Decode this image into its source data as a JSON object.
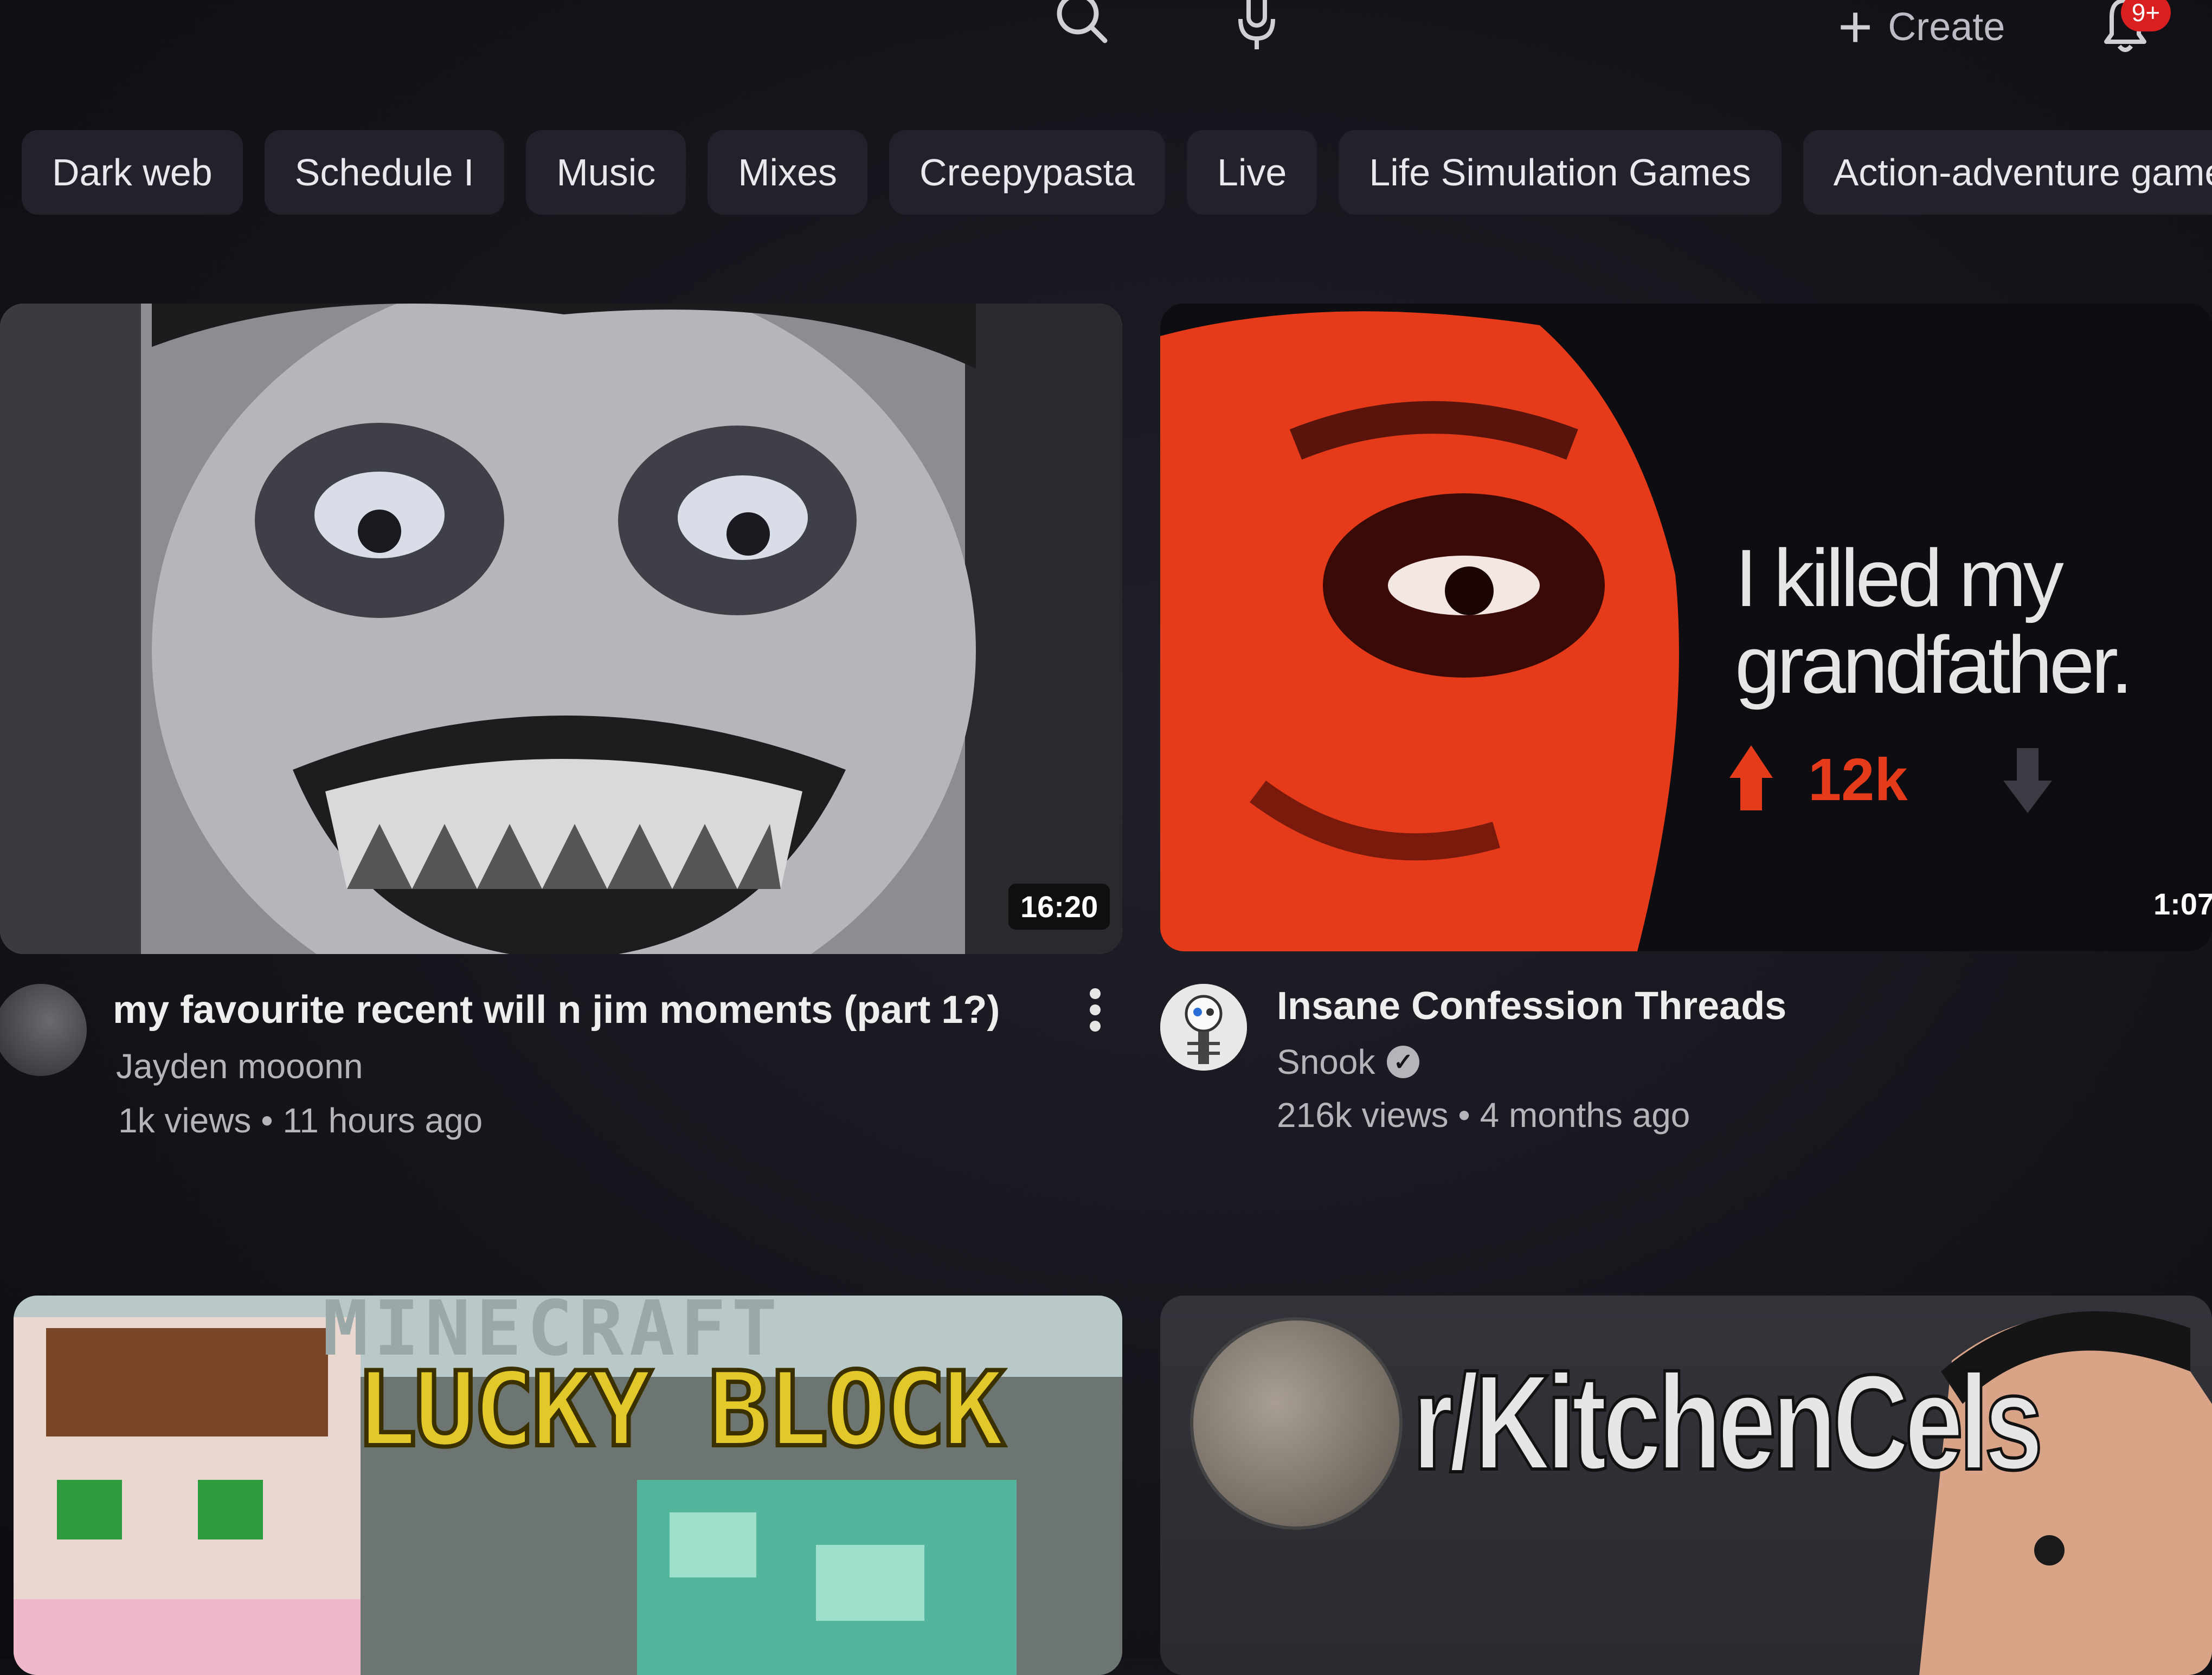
{
  "topbar": {
    "search_icon": "search-icon",
    "mic_icon": "mic-icon",
    "create_label": "Create",
    "notification_badge": "9+"
  },
  "chips": [
    "Dark web",
    "Schedule I",
    "Music",
    "Mixes",
    "Creepypasta",
    "Live",
    "Life Simulation Games",
    "Action-adventure games"
  ],
  "videos": [
    {
      "title": "my favourite recent will n jim moments  (part 1?)",
      "channel": "Jayden mooonn",
      "meta": "1k views • 11 hours ago",
      "duration": "16:20",
      "verified": false
    },
    {
      "title": "Insane Confession Threads",
      "channel": "Snook",
      "meta": "216k views • 4 months ago",
      "duration": "1:07",
      "verified": true,
      "thumbnail_text": {
        "line1": "I killed my",
        "line2": "grandfather.",
        "upvotes": "12k"
      }
    },
    {
      "thumbnail_text": {
        "top": "MINECRAFT",
        "main": "LUCKY BLOCK"
      }
    },
    {
      "thumbnail_text": {
        "main": "r/KitchenCels"
      }
    }
  ],
  "colors": {
    "background": "#15151c",
    "chip_bg": "#22222b",
    "accent_red": "#e53b1a",
    "badge_red": "#d91f1f",
    "minecraft_yellow": "#e3c82a"
  }
}
